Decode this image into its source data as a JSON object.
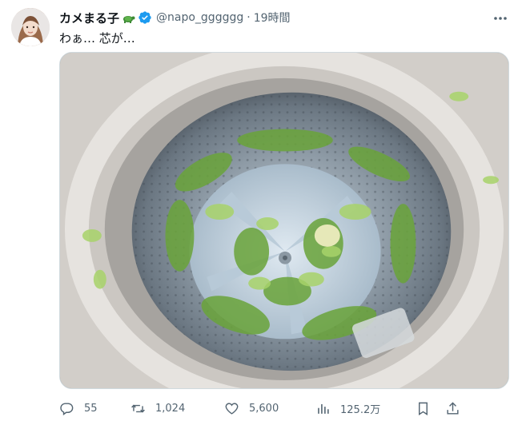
{
  "tweet": {
    "display_name": "カメまる子",
    "handle": "@napo_gggggg",
    "separator": "·",
    "time": "19時間",
    "text": "わぁ… 芯が…",
    "name_emoji_icon": "turtle-icon",
    "verified_icon": "verified-badge-icon"
  },
  "media": {
    "image_icon": "washing-machine-drum-with-shredded-cabbage"
  },
  "actions": {
    "reply_count": "55",
    "retweet_count": "1,024",
    "like_count": "5,600",
    "view_count": "125.2万"
  },
  "colors": {
    "verified": "#1d9bf0",
    "secondary_text": "#536471",
    "border": "#cfd9de"
  }
}
